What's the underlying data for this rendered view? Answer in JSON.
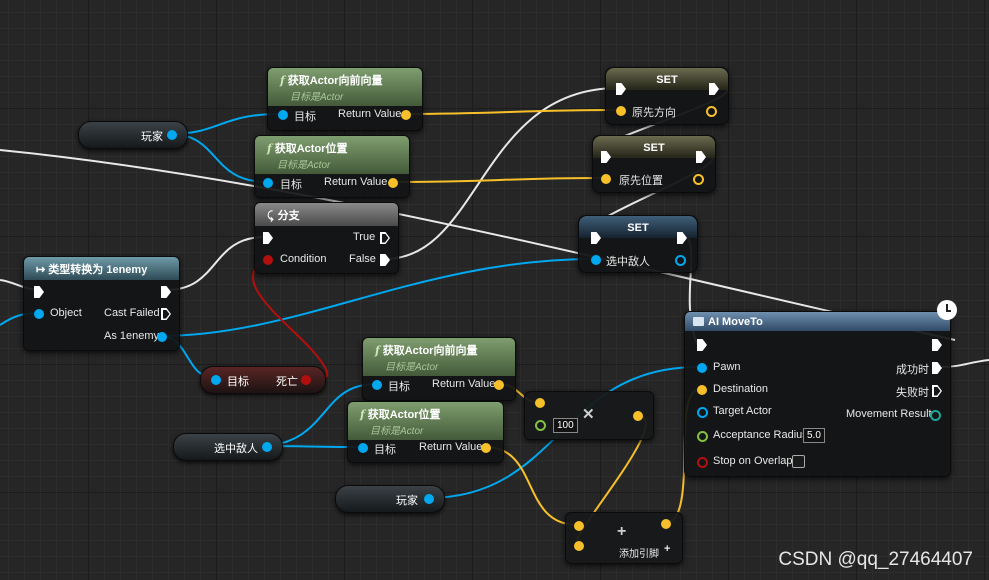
{
  "nodes": {
    "get_forward_1": {
      "title": "获取Actor向前向量",
      "subtitle": "目标是Actor",
      "in_label": "目标",
      "out_label": "Return Value"
    },
    "get_location_1": {
      "title": "获取Actor位置",
      "subtitle": "目标是Actor",
      "in_label": "目标",
      "out_label": "Return Value"
    },
    "get_forward_2": {
      "title": "获取Actor向前向量",
      "subtitle": "目标是Actor",
      "in_label": "目标",
      "out_label": "Return Value"
    },
    "get_location_2": {
      "title": "获取Actor位置",
      "subtitle": "目标是Actor",
      "in_label": "目标",
      "out_label": "Return Value"
    },
    "branch": {
      "title": "分支",
      "condition": "Condition",
      "true": "True",
      "false": "False"
    },
    "cast": {
      "title": "类型转换为 1enemy",
      "object": "Object",
      "cast_failed": "Cast Failed",
      "as_enemy": "As 1enemy"
    },
    "set_dir": {
      "title": "SET",
      "var": "原先方向"
    },
    "set_pos": {
      "title": "SET",
      "var": "原先位置"
    },
    "set_enemy": {
      "title": "SET",
      "var": "选中敌人"
    },
    "ai_move": {
      "title": "AI MoveTo",
      "pawn": "Pawn",
      "destination": "Destination",
      "target_actor": "Target Actor",
      "acceptance_radius": "Acceptance Radius",
      "acceptance_radius_value": "5.0",
      "stop_on_overlap": "Stop on Overlap",
      "on_success": "成功时",
      "on_fail": "失败时",
      "movement_result": "Movement Result"
    },
    "multiply": {
      "value": "100"
    },
    "add": {
      "add_pin": "添加引脚"
    },
    "dead_get": {
      "target": "目标",
      "value": "死亡"
    }
  },
  "variables": {
    "player_1": "玩家",
    "selected_enemy": "选中敌人",
    "player_2": "玩家"
  },
  "watermark": "CSDN @qq_27464407",
  "colors": {
    "exec": "#ffffff",
    "object": "#00a8f0",
    "vector": "#f7c02a",
    "bool": "#b20f0f",
    "float": "#84c043"
  }
}
